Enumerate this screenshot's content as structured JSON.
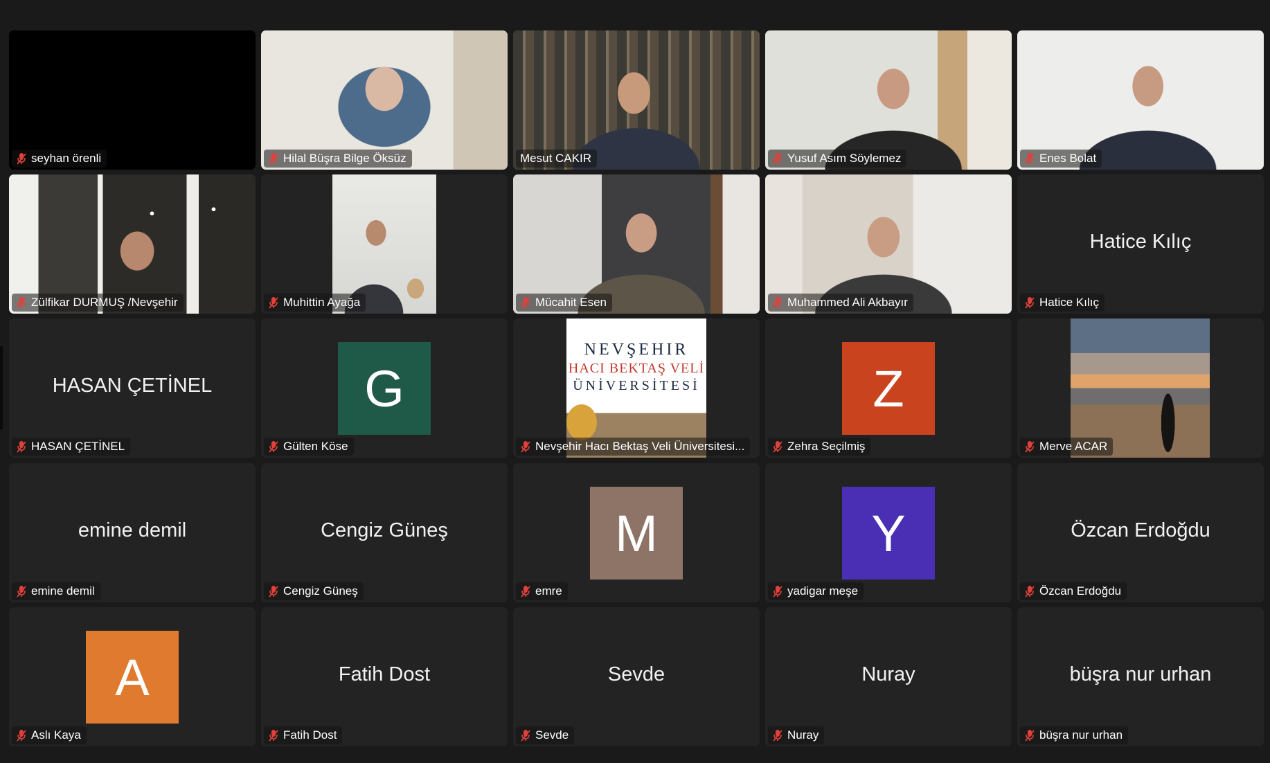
{
  "participants": [
    {
      "name": "seyhan örenli"
    },
    {
      "name": "Hilal Büşra Bilge Öksüz"
    },
    {
      "name": "Mesut CAKIR"
    },
    {
      "name": "Yusuf Asım Söylemez"
    },
    {
      "name": "Enes Bolat"
    },
    {
      "name": "Zülfikar DURMUŞ /Nevşehir"
    },
    {
      "name": "Muhittin Ayağa"
    },
    {
      "name": "Mücahit Esen"
    },
    {
      "name": "Muhammed Ali Akbayır"
    },
    {
      "name": "Hatice Kılıç",
      "big": "Hatice Kılıç"
    },
    {
      "name": "HASAN ÇETİNEL",
      "big": "HASAN ÇETİNEL"
    },
    {
      "name": "Gülten Köse",
      "initial": "G"
    },
    {
      "name": "Nevşehir Hacı Bektaş Veli Üniversitesi..."
    },
    {
      "name": "Zehra Seçilmiş",
      "initial": "Z"
    },
    {
      "name": "Merve ACAR"
    },
    {
      "name": "emine demil",
      "big": "emine demil"
    },
    {
      "name": "Cengiz Güneş",
      "big": "Cengiz Güneş"
    },
    {
      "name": "emre",
      "initial": "M"
    },
    {
      "name": "yadigar meşe",
      "initial": "Y"
    },
    {
      "name": "Özcan Erdoğdu",
      "big": "Özcan Erdoğdu"
    },
    {
      "name": "Aslı Kaya",
      "initial": "A"
    },
    {
      "name": "Fatih Dost",
      "big": "Fatih Dost"
    },
    {
      "name": "Sevde",
      "big": "Sevde"
    },
    {
      "name": "Nuray",
      "big": "Nuray"
    },
    {
      "name": "büşra nur urhan",
      "big": "büşra nur urhan"
    }
  ],
  "logo": {
    "line1": "NEVŞEHIR",
    "line2": "HACI BEKTAŞ VELİ",
    "line3": "ÜNİVERSİTESİ"
  },
  "colors": {
    "active_speaker": "#62c95a",
    "mic_muted": "#e0413a",
    "avatar_G": "#1f5a48",
    "avatar_Z": "#c9431f",
    "avatar_M": "#8d7466",
    "avatar_Y": "#4a2fb5",
    "avatar_A": "#e07a2e"
  }
}
